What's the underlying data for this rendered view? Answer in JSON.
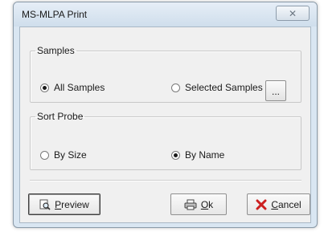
{
  "window": {
    "title": "MS-MLPA Print",
    "close_glyph": "✕"
  },
  "samples_group": {
    "legend": "Samples",
    "options": [
      {
        "label": "All Samples",
        "selected": true
      },
      {
        "label": "Selected Samples",
        "selected": false
      }
    ],
    "browse_button_label": "..."
  },
  "sort_group": {
    "legend": "Sort Probe",
    "options": [
      {
        "label": "By Size",
        "selected": false
      },
      {
        "label": "By Name",
        "selected": true
      }
    ]
  },
  "buttons": {
    "preview_label": "Preview",
    "ok_label": "Ok",
    "cancel_label": "Cancel"
  },
  "icons": {
    "preview": "preview-magnifier-icon",
    "ok": "printer-icon",
    "cancel": "red-x-icon"
  },
  "colors": {
    "cancel_icon": "#cc1f1f"
  }
}
